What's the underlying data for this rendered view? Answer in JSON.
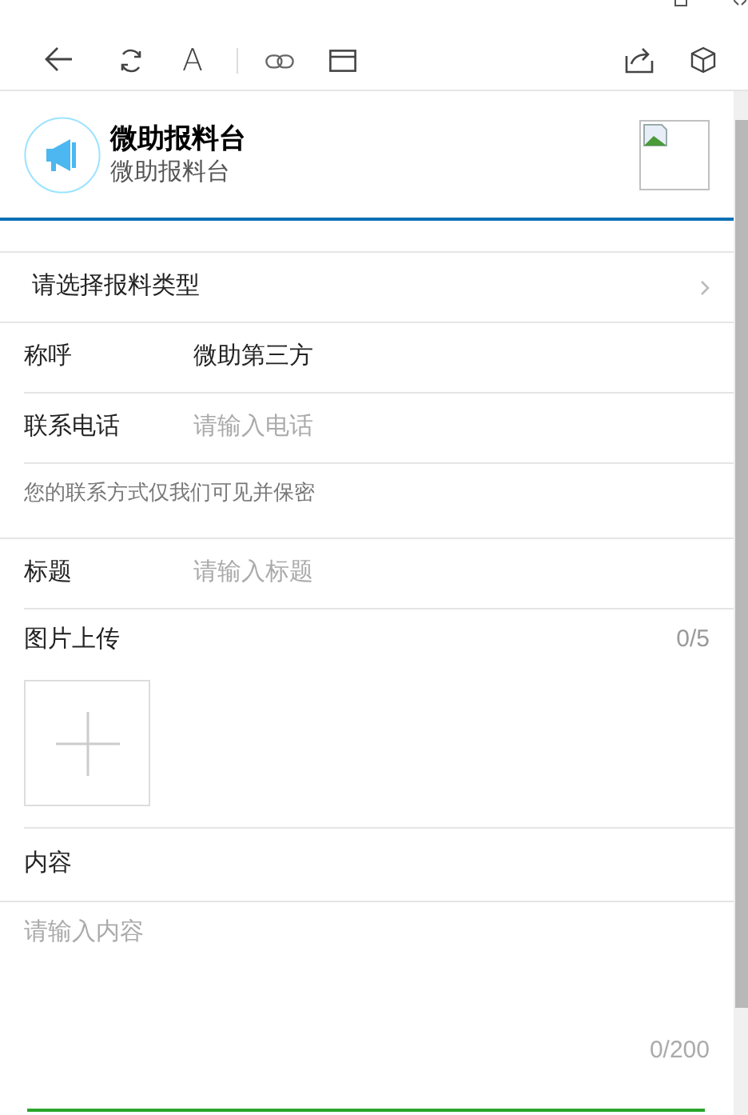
{
  "toolbar": {
    "font_button": "A"
  },
  "header": {
    "title": "微助报料台",
    "subtitle": "微助报料台"
  },
  "type_picker": {
    "label": "请选择报料类型"
  },
  "fields": [
    {
      "label": "称呼",
      "value": "微助第三方"
    },
    {
      "label": "联系电话",
      "placeholder": "请输入电话"
    }
  ],
  "privacy_note": "您的联系方式仅我们可见并保密",
  "title_field": {
    "label": "标题",
    "placeholder": "请输入标题"
  },
  "image_upload": {
    "label": "图片上传",
    "count": "0/5"
  },
  "content": {
    "label": "内容",
    "placeholder": "请输入内容",
    "counter": "0/200"
  }
}
